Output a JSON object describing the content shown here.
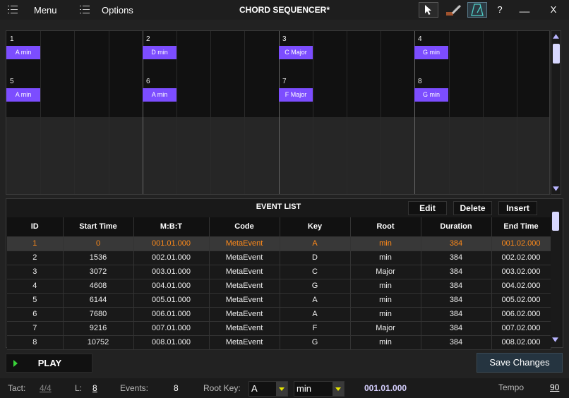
{
  "titlebar": {
    "menu_label": "Menu",
    "options_label": "Options",
    "title": "CHORD SEQUENCER*",
    "help_label": "?",
    "minimize_label": "__",
    "close_label": "X"
  },
  "grid": {
    "blocks": [
      {
        "bar": "1",
        "chord": "A min"
      },
      {
        "bar": "2",
        "chord": "D min"
      },
      {
        "bar": "3",
        "chord": "C Major"
      },
      {
        "bar": "4",
        "chord": "G min"
      },
      {
        "bar": "5",
        "chord": "A min"
      },
      {
        "bar": "6",
        "chord": "A min"
      },
      {
        "bar": "7",
        "chord": "F Major"
      },
      {
        "bar": "8",
        "chord": "G min"
      }
    ]
  },
  "event_list": {
    "title": "EVENT LIST",
    "edit_label": "Edit",
    "delete_label": "Delete",
    "insert_label": "Insert",
    "columns": [
      "ID",
      "Start Time",
      "M:B:T",
      "Code",
      "Key",
      "Root",
      "Duration",
      "End Time"
    ],
    "rows": [
      [
        "1",
        "0",
        "001.01.000",
        "MetaEvent",
        "A",
        "min",
        "384",
        "001.02.000"
      ],
      [
        "2",
        "1536",
        "002.01.000",
        "MetaEvent",
        "D",
        "min",
        "384",
        "002.02.000"
      ],
      [
        "3",
        "3072",
        "003.01.000",
        "MetaEvent",
        "C",
        "Major",
        "384",
        "003.02.000"
      ],
      [
        "4",
        "4608",
        "004.01.000",
        "MetaEvent",
        "G",
        "min",
        "384",
        "004.02.000"
      ],
      [
        "5",
        "6144",
        "005.01.000",
        "MetaEvent",
        "A",
        "min",
        "384",
        "005.02.000"
      ],
      [
        "6",
        "7680",
        "006.01.000",
        "MetaEvent",
        "A",
        "min",
        "384",
        "006.02.000"
      ],
      [
        "7",
        "9216",
        "007.01.000",
        "MetaEvent",
        "F",
        "Major",
        "384",
        "007.02.000"
      ],
      [
        "8",
        "10752",
        "008.01.000",
        "MetaEvent",
        "G",
        "min",
        "384",
        "008.02.000"
      ]
    ],
    "selected_row": 0
  },
  "controls": {
    "play_label": "PLAY",
    "save_label": "Save Changes"
  },
  "status": {
    "tact_label": "Tact:",
    "tact_value": "4/4",
    "length_label": "L:",
    "length_value": "8",
    "events_label": "Events:",
    "events_value": "8",
    "root_key_label": "Root Key:",
    "root_key_value": "A",
    "mode_value": "min",
    "position": "001.01.000",
    "tempo_label": "Tempo",
    "tempo_value": "90"
  },
  "colors": {
    "chord_block": "#7c4dff",
    "selected_row_text": "#ff8a1a",
    "play_icon": "#39d339",
    "dropdown_arrow": "#e6e600"
  }
}
